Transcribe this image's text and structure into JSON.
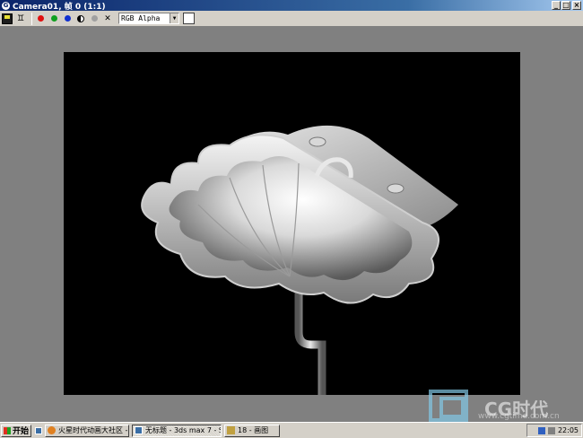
{
  "window": {
    "title": "Camera01, 帧 0 (1:1)",
    "controls": {
      "minimize": "_",
      "maximize": "□",
      "close": "×"
    }
  },
  "toolbar": {
    "clone_label": "♊",
    "clear_label": "✕",
    "channel": "RGB Alpha",
    "channel_arrow": "▼",
    "swatch_color": "#ffffff"
  },
  "render": {
    "content": "rendered washbasin"
  },
  "watermark": {
    "brand": "CG时代",
    "url": "www.cgtime.com.cn"
  },
  "taskbar": {
    "start_label": "开始",
    "tasks": [
      {
        "label": "火星时代动画大社区 - ..."
      },
      {
        "label": "无标题 - 3ds max 7 - St..."
      },
      {
        "label": "18 - 画图"
      }
    ],
    "clock": "22:05"
  },
  "colors": {
    "titlebar_start": "#0a246a",
    "titlebar_end": "#a6caf0",
    "chrome": "#d4d0c8",
    "desktop": "#808080",
    "render_bg": "#000000"
  }
}
